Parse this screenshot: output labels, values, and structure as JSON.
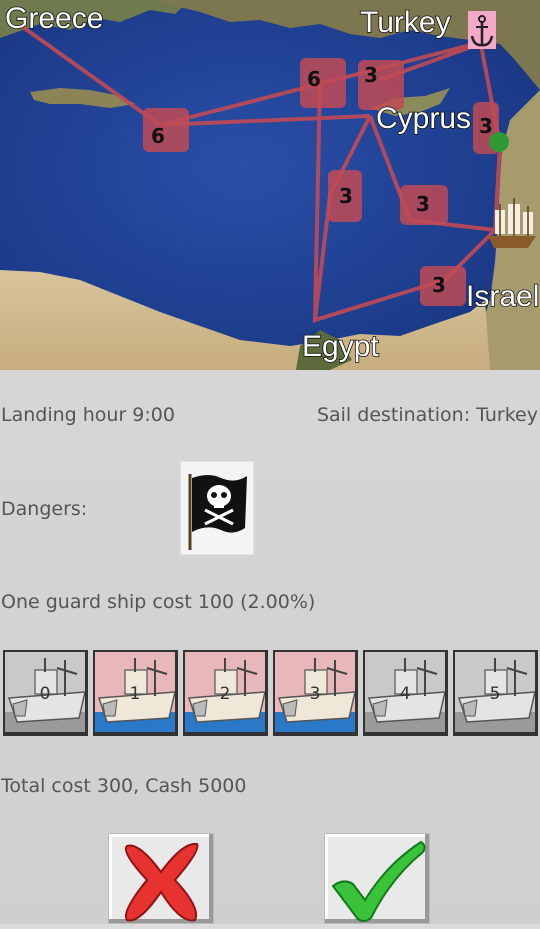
{
  "map": {
    "places": {
      "greece": "Greece",
      "turkey": "Turkey",
      "cyprus": "Cyprus",
      "israel": "Israel",
      "egypt": "Egypt"
    },
    "route_days": {
      "greece_cyprus": "6",
      "greece_turkey_west": "6",
      "turkey_cyprus": "3",
      "cyprus_east": "3",
      "sea_mid": "3",
      "israel_north": "3",
      "israel_egypt": "3"
    },
    "colors": {
      "route": "#c04a55",
      "sea": "#1f3f8c",
      "land": "#c9b48a",
      "player_marker": "#2f9a35"
    }
  },
  "info": {
    "landing": "Landing hour 9:00",
    "destination": "Sail destination: Turkey",
    "dangers_label": "Dangers:",
    "danger_icon": "pirate-flag-icon",
    "guard_cost": "One guard ship cost 100 (2.00%)",
    "total": "Total cost 300, Cash 5000"
  },
  "guard_ships": {
    "options": [
      "0",
      "1",
      "2",
      "3",
      "4",
      "5"
    ],
    "selected_count": 3
  },
  "buttons": {
    "cancel_icon": "red-x-icon",
    "confirm_icon": "green-check-icon"
  }
}
